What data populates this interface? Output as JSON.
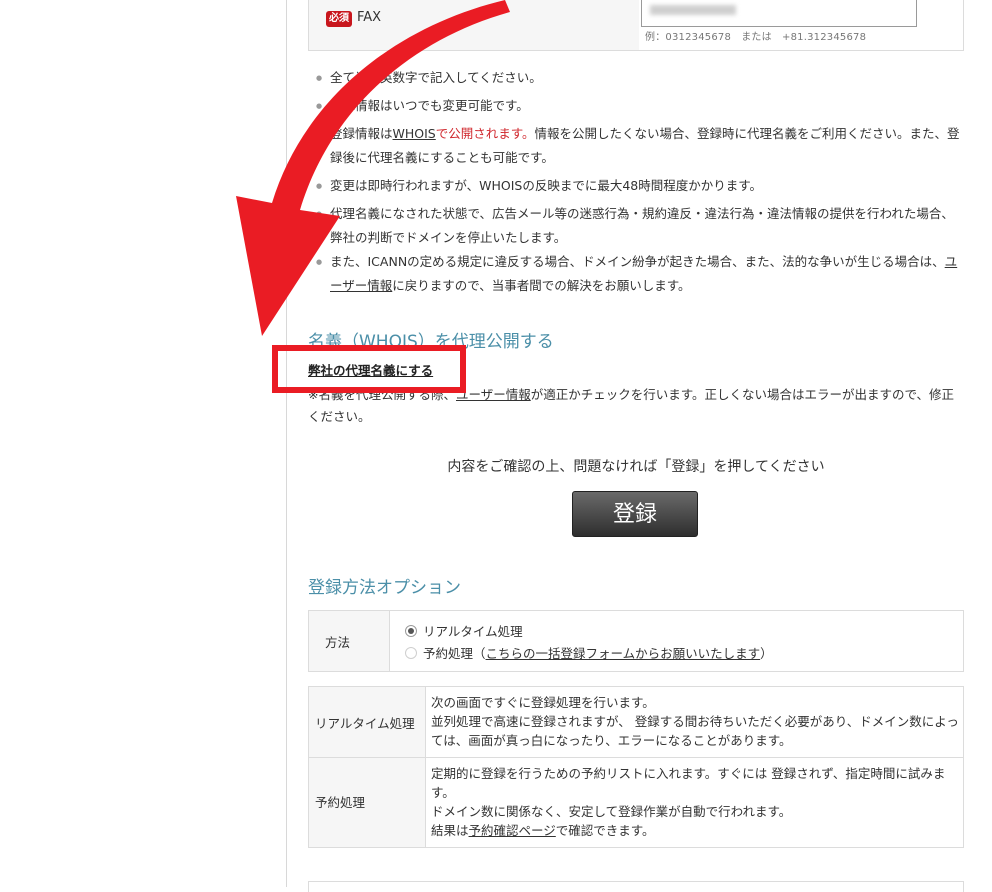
{
  "fax": {
    "required_badge": "必須",
    "label": "FAX",
    "example": "例：0312345678　または　+81.312345678"
  },
  "notes": {
    "n1": "全て半角英数字で記入してください。",
    "n2": "登録情報はいつでも変更可能です。",
    "n3_a": "登録情報は",
    "n3_link": "WHOIS",
    "n3_red": "で公開されます。",
    "n3_b": "情報を公開したくない場合、登録時に代理名義をご利用ください。また、登録後に代理名義にすることも可能です。",
    "n4": "変更は即時行われますが、WHOISの反映までに最大48時間程度かかります。",
    "n5": "代理名義になされた状態で、広告メール等の迷惑行為・規約違反・違法行為・違法情報の提供を行われた場合、弊社の判断でドメインを停止いたします。",
    "n6_a": "また、ICANNの定める規定に違反する場合、ドメイン紛争が起きた場合、また、法的な争いが生じる場合は、",
    "n6_link": "ユーザー情報",
    "n6_b": "に戻りますので、当事者間での解決をお願いします。"
  },
  "proxy": {
    "heading": "名義（WHOIS）を代理公開する",
    "link": "弊社の代理名義にする",
    "note_a": "※名義を代理公開する際、",
    "note_link": "ユーザー情報",
    "note_b": "が適正かチェックを行います。正しくない場合はエラーが出ますので、修正ください。"
  },
  "confirm": {
    "text": "内容をご確認の上、問題なければ「登録」を押してください",
    "button": "登録"
  },
  "options": {
    "heading": "登録方法オプション",
    "method_label": "方法",
    "radio_realtime": "リアルタイム処理",
    "radio_reserve_a": "予約処理（",
    "radio_reserve_link": "こちらの一括登録フォームからお願いいたします",
    "radio_reserve_b": "）"
  },
  "explain": {
    "realtime_label": "リアルタイム処理",
    "realtime_l1": "次の画面ですぐに登録処理を行います。",
    "realtime_l2": "並列処理で高速に登録されますが、 登録する間お待ちいただく必要があり、ドメイン数によっては、画面が真っ白になったり、エラーになることがあります。",
    "reserve_label": "予約処理",
    "reserve_l1": "定期的に登録を行うための予約リストに入れます。すぐには 登録されず、指定時間に試みます。",
    "reserve_l2": "ドメイン数に関係なく、安定して登録作業が自動で行われます。",
    "reserve_l3_a": "結果は",
    "reserve_l3_link": "予約確認ページ",
    "reserve_l3_b": "で確認できます。"
  },
  "colors": {
    "annotation_red": "#ea1c24",
    "heading_blue": "#4b8fa8",
    "required_red": "#c8161d"
  }
}
